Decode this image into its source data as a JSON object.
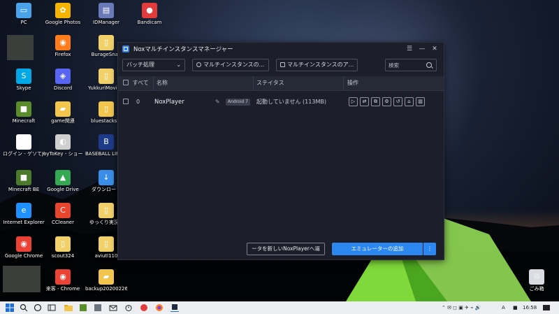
{
  "desktop": {
    "icons": [
      {
        "label": "PC",
        "color": "#4aa3e8",
        "glyph": "▭"
      },
      {
        "label": "Google Photos",
        "color": "#f4b400",
        "glyph": "✿"
      },
      {
        "label": "IDManager",
        "color": "#6a7ab8",
        "glyph": "▤"
      },
      {
        "label": "Bandicam",
        "color": "#e23b3b",
        "glyph": "●"
      },
      {
        "label": "Firefox",
        "color": "#ff7b1c",
        "glyph": "◉"
      },
      {
        "label": "BurageSnap",
        "color": "#f2d16b",
        "glyph": "▯"
      },
      {
        "label": "Skype",
        "color": "#00a8e8",
        "glyph": "S"
      },
      {
        "label": "Discord",
        "color": "#5865f2",
        "glyph": "◈"
      },
      {
        "label": "YukkuriMovieM",
        "color": "#f2d16b",
        "glyph": "▯"
      },
      {
        "label": "Minecraft",
        "color": "#5b8c2a",
        "glyph": "■"
      },
      {
        "label": "game関連",
        "color": "#f2c64d",
        "glyph": "▰"
      },
      {
        "label": "bluestacks a",
        "color": "#f2c64d",
        "glyph": "▯"
      },
      {
        "label": "ログイン - ゲソてん byGMO",
        "color": "#ffffff",
        "glyph": "◎"
      },
      {
        "label": "JoyToKey - ショートカット",
        "color": "#cfcfcf",
        "glyph": "◐"
      },
      {
        "label": "BASEBALL LIFE 白野球人生シ",
        "color": "#1e3b8a",
        "glyph": "B"
      },
      {
        "label": "Minecraft BE",
        "color": "#4a7a2a",
        "glyph": "■"
      },
      {
        "label": "Google Drive",
        "color": "#34a853",
        "glyph": "▲"
      },
      {
        "label": "ダウンロード",
        "color": "#3b8ee8",
        "glyph": "↓"
      },
      {
        "label": "Internet Explorer",
        "color": "#1e90ff",
        "glyph": "e"
      },
      {
        "label": "CCleaner",
        "color": "#e8452f",
        "glyph": "C"
      },
      {
        "label": "ゆっくり実況 F",
        "color": "#f2d16b",
        "glyph": "▯"
      },
      {
        "label": "Google Chrome",
        "color": "#ea4335",
        "glyph": "◉"
      },
      {
        "label": "scout324",
        "color": "#f2d16b",
        "glyph": "▯"
      },
      {
        "label": "aviutl110",
        "color": "#f2d16b",
        "glyph": "▯"
      },
      {
        "label": "来客 - Chrome",
        "color": "#ea4335",
        "glyph": "◉"
      },
      {
        "label": "backup20200226...",
        "color": "#f2c64d",
        "glyph": "▰"
      },
      {
        "label": "ごみ箱",
        "color": "#d9dde3",
        "glyph": "♲"
      }
    ]
  },
  "window": {
    "title": "Noxマルチインスタンスマネージャー",
    "controls": {
      "menu": "☰",
      "minimize": "—",
      "close": "✕"
    },
    "toolbar": {
      "batch_label": "バッチ処理",
      "multi_instance_label": "マルチインスタンスの...",
      "multi_instance2_label": "マルチインスタンスのア...",
      "search_placeholder": "検索"
    },
    "table": {
      "headers": {
        "all": "すべて",
        "name": "名称",
        "status": "ステイタス",
        "ops": "操作"
      },
      "rows": [
        {
          "index": "0",
          "name": "NoxPlayer",
          "badge": "Android 7",
          "status": "起動していません (113MB)"
        }
      ],
      "op_icons": [
        "play-icon",
        "copy-icon",
        "clone-icon",
        "settings-icon",
        "history-icon",
        "shortcut-icon",
        "delete-icon"
      ]
    },
    "footer": {
      "migrate_label": "ータを新しいNoxPlayerへ逼",
      "add_emulator_label": "エミュレーターの追加",
      "more_label": "⋮"
    }
  },
  "taskbar": {
    "time": "16:58",
    "ime": "A"
  }
}
